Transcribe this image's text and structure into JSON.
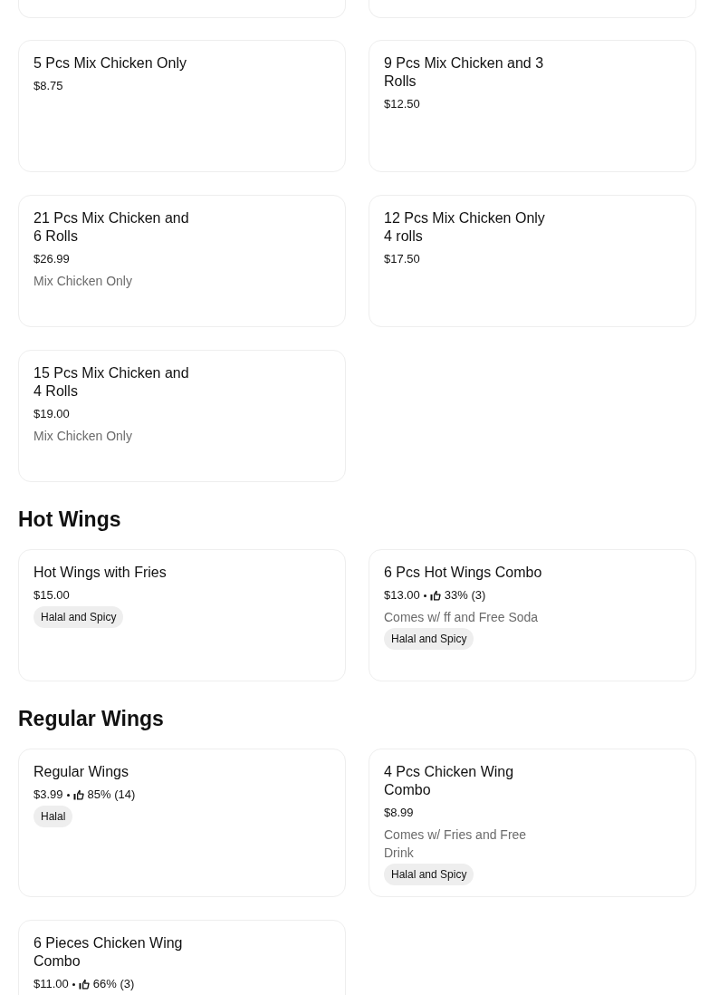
{
  "sections": [
    {
      "items": [
        {
          "name": "5 Pcs Mix Chicken Only",
          "price": "$8.75"
        },
        {
          "name": "9 Pcs Mix Chicken and 3 Rolls",
          "price": "$12.50"
        },
        {
          "name": "21 Pcs Mix Chicken and 6 Rolls",
          "price": "$26.99",
          "description": "Mix Chicken Only"
        },
        {
          "name": "12 Pcs Mix Chicken Only 4 rolls",
          "price": "$17.50"
        },
        {
          "name": "15 Pcs Mix Chicken and 4 Rolls",
          "price": "$19.00",
          "description": "Mix Chicken Only"
        }
      ]
    },
    {
      "heading": "Hot Wings",
      "items": [
        {
          "name": "Hot Wings with Fries",
          "price": "$15.00",
          "tag": "Halal and Spicy"
        },
        {
          "name": "6 Pcs Hot Wings Combo",
          "price": "$13.00",
          "rating": "33% (3)",
          "description": "Comes w/ ff and Free Soda",
          "tag": "Halal and Spicy"
        }
      ]
    },
    {
      "heading": "Regular Wings",
      "items": [
        {
          "name": "Regular Wings",
          "price": "$3.99",
          "rating": "85% (14)",
          "tag": "Halal"
        },
        {
          "name": "4 Pcs Chicken Wing Combo",
          "price": "$8.99",
          "description": "Comes w/ Fries and Free Drink",
          "tag": "Halal and Spicy"
        },
        {
          "name": "6 Pieces Chicken Wing Combo",
          "price": "$11.00",
          "rating": "66% (3)"
        }
      ]
    }
  ]
}
